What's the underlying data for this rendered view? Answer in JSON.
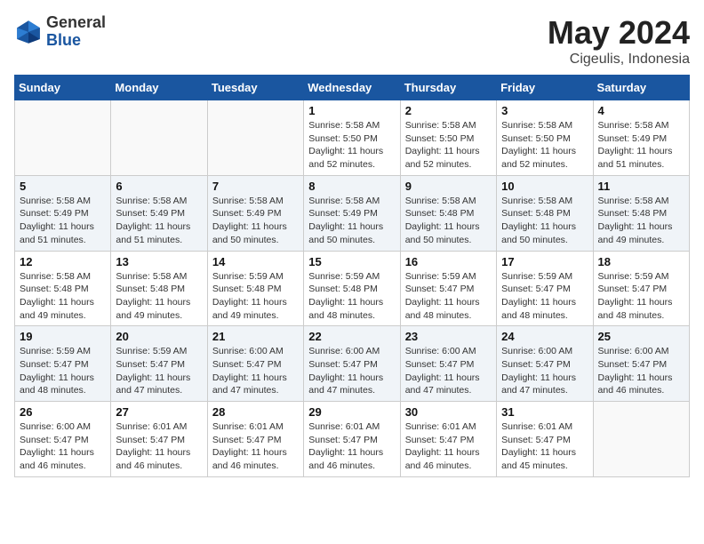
{
  "logo": {
    "general": "General",
    "blue": "Blue"
  },
  "title": {
    "month_year": "May 2024",
    "location": "Cigeulis, Indonesia"
  },
  "days_of_week": [
    "Sunday",
    "Monday",
    "Tuesday",
    "Wednesday",
    "Thursday",
    "Friday",
    "Saturday"
  ],
  "weeks": [
    [
      {
        "day": "",
        "detail": ""
      },
      {
        "day": "",
        "detail": ""
      },
      {
        "day": "",
        "detail": ""
      },
      {
        "day": "1",
        "detail": "Sunrise: 5:58 AM\nSunset: 5:50 PM\nDaylight: 11 hours\nand 52 minutes."
      },
      {
        "day": "2",
        "detail": "Sunrise: 5:58 AM\nSunset: 5:50 PM\nDaylight: 11 hours\nand 52 minutes."
      },
      {
        "day": "3",
        "detail": "Sunrise: 5:58 AM\nSunset: 5:50 PM\nDaylight: 11 hours\nand 52 minutes."
      },
      {
        "day": "4",
        "detail": "Sunrise: 5:58 AM\nSunset: 5:49 PM\nDaylight: 11 hours\nand 51 minutes."
      }
    ],
    [
      {
        "day": "5",
        "detail": "Sunrise: 5:58 AM\nSunset: 5:49 PM\nDaylight: 11 hours\nand 51 minutes."
      },
      {
        "day": "6",
        "detail": "Sunrise: 5:58 AM\nSunset: 5:49 PM\nDaylight: 11 hours\nand 51 minutes."
      },
      {
        "day": "7",
        "detail": "Sunrise: 5:58 AM\nSunset: 5:49 PM\nDaylight: 11 hours\nand 50 minutes."
      },
      {
        "day": "8",
        "detail": "Sunrise: 5:58 AM\nSunset: 5:49 PM\nDaylight: 11 hours\nand 50 minutes."
      },
      {
        "day": "9",
        "detail": "Sunrise: 5:58 AM\nSunset: 5:48 PM\nDaylight: 11 hours\nand 50 minutes."
      },
      {
        "day": "10",
        "detail": "Sunrise: 5:58 AM\nSunset: 5:48 PM\nDaylight: 11 hours\nand 50 minutes."
      },
      {
        "day": "11",
        "detail": "Sunrise: 5:58 AM\nSunset: 5:48 PM\nDaylight: 11 hours\nand 49 minutes."
      }
    ],
    [
      {
        "day": "12",
        "detail": "Sunrise: 5:58 AM\nSunset: 5:48 PM\nDaylight: 11 hours\nand 49 minutes."
      },
      {
        "day": "13",
        "detail": "Sunrise: 5:58 AM\nSunset: 5:48 PM\nDaylight: 11 hours\nand 49 minutes."
      },
      {
        "day": "14",
        "detail": "Sunrise: 5:59 AM\nSunset: 5:48 PM\nDaylight: 11 hours\nand 49 minutes."
      },
      {
        "day": "15",
        "detail": "Sunrise: 5:59 AM\nSunset: 5:48 PM\nDaylight: 11 hours\nand 48 minutes."
      },
      {
        "day": "16",
        "detail": "Sunrise: 5:59 AM\nSunset: 5:47 PM\nDaylight: 11 hours\nand 48 minutes."
      },
      {
        "day": "17",
        "detail": "Sunrise: 5:59 AM\nSunset: 5:47 PM\nDaylight: 11 hours\nand 48 minutes."
      },
      {
        "day": "18",
        "detail": "Sunrise: 5:59 AM\nSunset: 5:47 PM\nDaylight: 11 hours\nand 48 minutes."
      }
    ],
    [
      {
        "day": "19",
        "detail": "Sunrise: 5:59 AM\nSunset: 5:47 PM\nDaylight: 11 hours\nand 48 minutes."
      },
      {
        "day": "20",
        "detail": "Sunrise: 5:59 AM\nSunset: 5:47 PM\nDaylight: 11 hours\nand 47 minutes."
      },
      {
        "day": "21",
        "detail": "Sunrise: 6:00 AM\nSunset: 5:47 PM\nDaylight: 11 hours\nand 47 minutes."
      },
      {
        "day": "22",
        "detail": "Sunrise: 6:00 AM\nSunset: 5:47 PM\nDaylight: 11 hours\nand 47 minutes."
      },
      {
        "day": "23",
        "detail": "Sunrise: 6:00 AM\nSunset: 5:47 PM\nDaylight: 11 hours\nand 47 minutes."
      },
      {
        "day": "24",
        "detail": "Sunrise: 6:00 AM\nSunset: 5:47 PM\nDaylight: 11 hours\nand 47 minutes."
      },
      {
        "day": "25",
        "detail": "Sunrise: 6:00 AM\nSunset: 5:47 PM\nDaylight: 11 hours\nand 46 minutes."
      }
    ],
    [
      {
        "day": "26",
        "detail": "Sunrise: 6:00 AM\nSunset: 5:47 PM\nDaylight: 11 hours\nand 46 minutes."
      },
      {
        "day": "27",
        "detail": "Sunrise: 6:01 AM\nSunset: 5:47 PM\nDaylight: 11 hours\nand 46 minutes."
      },
      {
        "day": "28",
        "detail": "Sunrise: 6:01 AM\nSunset: 5:47 PM\nDaylight: 11 hours\nand 46 minutes."
      },
      {
        "day": "29",
        "detail": "Sunrise: 6:01 AM\nSunset: 5:47 PM\nDaylight: 11 hours\nand 46 minutes."
      },
      {
        "day": "30",
        "detail": "Sunrise: 6:01 AM\nSunset: 5:47 PM\nDaylight: 11 hours\nand 46 minutes."
      },
      {
        "day": "31",
        "detail": "Sunrise: 6:01 AM\nSunset: 5:47 PM\nDaylight: 11 hours\nand 45 minutes."
      },
      {
        "day": "",
        "detail": ""
      }
    ]
  ]
}
